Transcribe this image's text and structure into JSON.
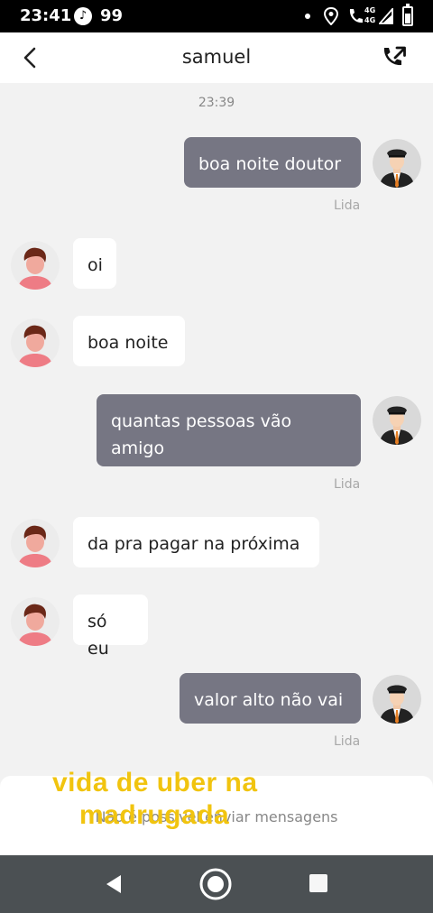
{
  "status_bar": {
    "time": "23:41",
    "notif_count": "99",
    "net1": "4G",
    "net2": "4G"
  },
  "header": {
    "title": "samuel",
    "back_icon": "chevron-left-icon",
    "call_icon": "phone-callback-icon"
  },
  "chat": {
    "timestamp": "23:39",
    "read_label": "Lida",
    "messages": [
      {
        "direction": "sent",
        "text": "boa noite doutor",
        "read": "Lida"
      },
      {
        "direction": "received",
        "text": "oi"
      },
      {
        "direction": "received",
        "text": "boa noite"
      },
      {
        "direction": "sent",
        "text": "quantas pessoas vão amigo",
        "read": "Lida"
      },
      {
        "direction": "received",
        "text": "da pra pagar na próxima"
      },
      {
        "direction": "received",
        "text": "só eu"
      },
      {
        "direction": "sent",
        "text": "valor alto não vai",
        "read": "Lida"
      }
    ]
  },
  "footer": {
    "notice": "Não é possível enviar mensagens"
  },
  "overlay_caption": {
    "line1": "vida de uber na",
    "line2": "madrugada"
  },
  "colors": {
    "sent_bubble": "#767683",
    "received_bubble": "#ffffff",
    "background": "#f2f2f2",
    "caption": "#f1c40f"
  }
}
